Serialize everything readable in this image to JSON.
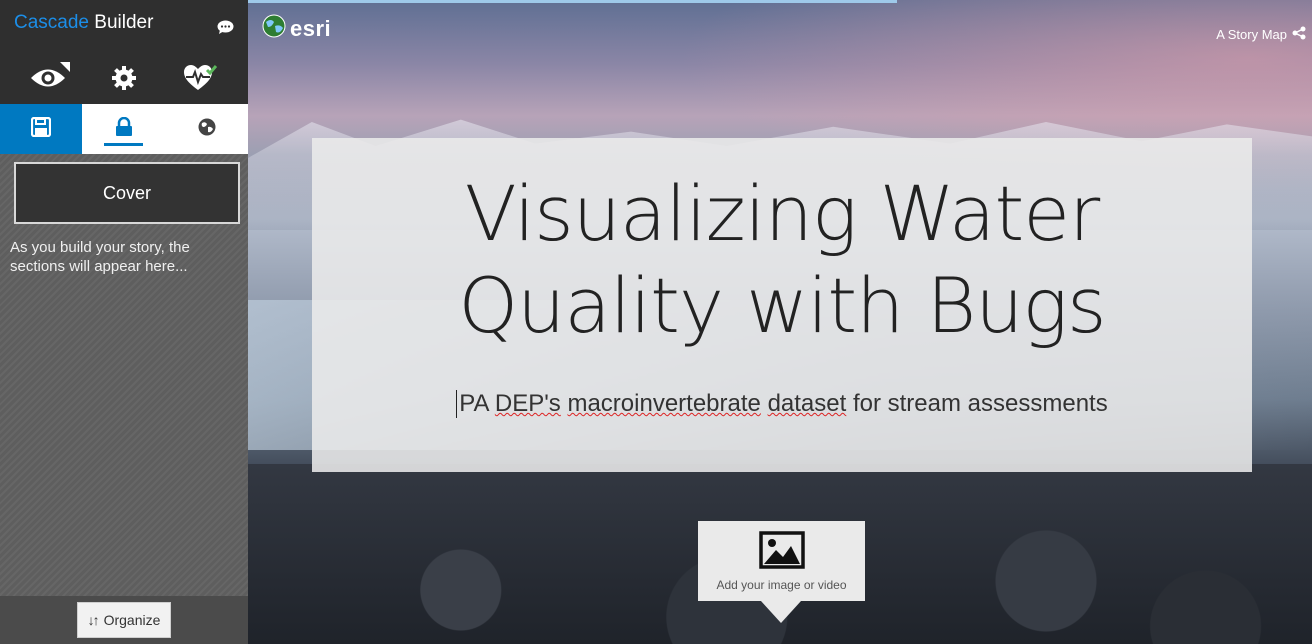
{
  "sidebar": {
    "title_brand": "Cascade",
    "title_rest": " Builder",
    "toolbar": {
      "preview_icon": "eye-icon",
      "settings_icon": "gear-icon",
      "health_icon": "heartbeat-check-icon"
    },
    "actions": {
      "save_icon": "floppy-disk-icon",
      "lock_icon": "lock-icon",
      "share_icon": "globe-icon"
    },
    "cover_label": "Cover",
    "hint": "As you build your story, the sections will appear here...",
    "organize_label": "Organize"
  },
  "main": {
    "logo_text": "esri",
    "story_map_label": "A Story Map",
    "title_line1": "Visualizing Water",
    "title_line2": "Quality with Bugs",
    "subtitle_parts": [
      "PA ",
      "DEP's",
      " ",
      "macroinvertebrate",
      " ",
      "dataset",
      " for stream assessments"
    ],
    "media_label": "Add your image or video",
    "load_progress": 0.61
  },
  "colors": {
    "accent": "#0079c1",
    "brand": "#1c8ee8",
    "sidebar_dark": "#2f2f2f"
  }
}
